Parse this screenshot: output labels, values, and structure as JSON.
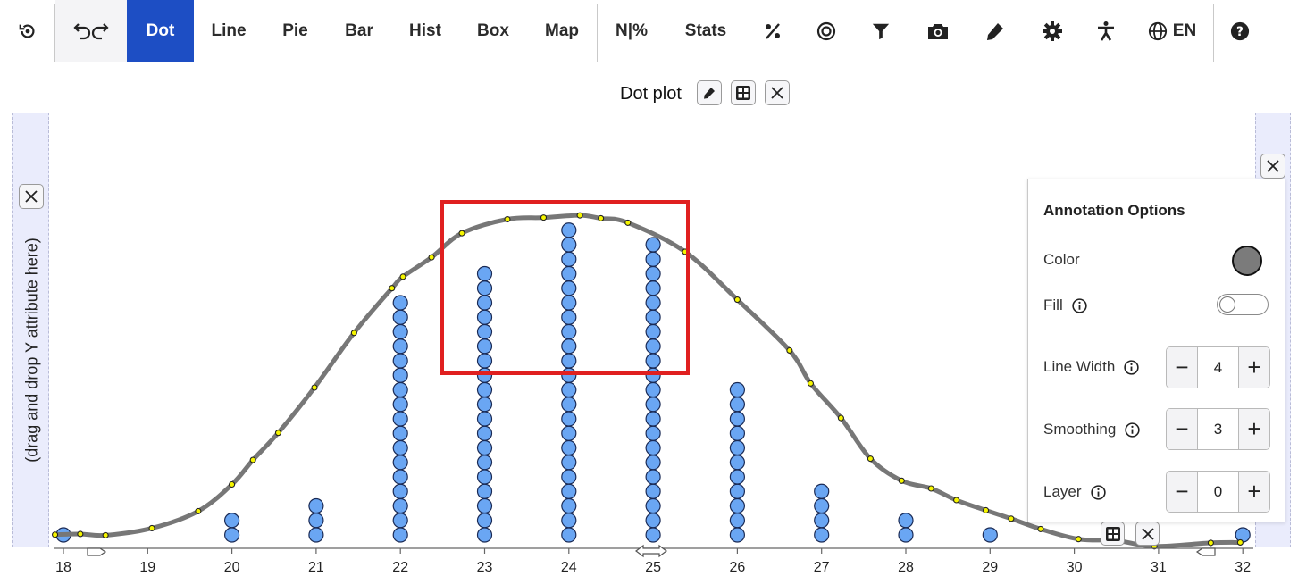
{
  "toolbar": {
    "undo_redo_icon": "undo-redo-icon",
    "reset_icon": "reset-icon",
    "tabs": [
      "Dot",
      "Line",
      "Pie",
      "Bar",
      "Hist",
      "Box",
      "Map"
    ],
    "active_tab": "Dot",
    "n_percent": "N|%",
    "stats": "Stats",
    "language": "EN",
    "accent_color": "#1d4ec4"
  },
  "plot": {
    "title": "Dot plot",
    "y_drop_hint": "(drag and drop Y attribute here)"
  },
  "chart_data": {
    "type": "scatter",
    "subtype": "dot plot with smoothed density line",
    "xlim": [
      18,
      32
    ],
    "x_ticks": [
      "18",
      "19",
      "20",
      "21",
      "22",
      "23",
      "24",
      "25",
      "26",
      "27",
      "28",
      "29",
      "30",
      "31",
      "32"
    ],
    "dot_counts": [
      {
        "x": 18,
        "count": 1
      },
      {
        "x": 20,
        "count": 2
      },
      {
        "x": 21,
        "count": 3
      },
      {
        "x": 22,
        "count": 17
      },
      {
        "x": 23,
        "count": 19
      },
      {
        "x": 24,
        "count": 22
      },
      {
        "x": 25,
        "count": 21
      },
      {
        "x": 26,
        "count": 11
      },
      {
        "x": 27,
        "count": 4
      },
      {
        "x": 28,
        "count": 2
      },
      {
        "x": 29,
        "count": 1
      },
      {
        "x": 32,
        "count": 1
      }
    ],
    "dot_color": "#6aa6f3",
    "curve": {
      "color": "#777777",
      "control_point_color": "#f5f500",
      "points": [
        [
          17.9,
          0.008
        ],
        [
          18.2,
          0.013
        ],
        [
          18.5,
          0.004
        ],
        [
          19.05,
          0.055
        ],
        [
          19.6,
          0.178
        ],
        [
          20.0,
          0.371
        ],
        [
          20.25,
          0.548
        ],
        [
          20.55,
          0.744
        ],
        [
          20.98,
          1.071
        ],
        [
          21.45,
          1.466
        ],
        [
          21.9,
          1.789
        ],
        [
          22.03,
          1.872
        ],
        [
          22.37,
          2.012
        ],
        [
          22.73,
          2.186
        ],
        [
          23.27,
          2.287
        ],
        [
          23.7,
          2.299
        ],
        [
          24.13,
          2.315
        ],
        [
          24.38,
          2.294
        ],
        [
          24.7,
          2.262
        ],
        [
          25.38,
          2.052
        ],
        [
          26.0,
          1.706
        ],
        [
          26.62,
          1.339
        ],
        [
          26.87,
          1.101
        ],
        [
          27.23,
          0.851
        ],
        [
          27.58,
          0.557
        ],
        [
          27.95,
          0.398
        ],
        [
          28.3,
          0.342
        ],
        [
          28.6,
          0.258
        ],
        [
          28.95,
          0.184
        ],
        [
          29.25,
          0.124
        ],
        [
          29.6,
          0.049
        ],
        [
          30.05,
          -0.024
        ],
        [
          30.5,
          -0.035
        ],
        [
          30.95,
          -0.076
        ],
        [
          31.62,
          -0.051
        ],
        [
          31.97,
          -0.048
        ]
      ],
      "ylim": [
        -0.1,
        2.5
      ]
    }
  },
  "highlight_box": {
    "color": "#e02020"
  },
  "annotation_panel": {
    "title": "Annotation Options",
    "color_label": "Color",
    "color_value": "#7b7b7b",
    "fill_label": "Fill",
    "fill_on": false,
    "line_width_label": "Line Width",
    "line_width_value": "4",
    "smoothing_label": "Smoothing",
    "smoothing_value": "3",
    "layer_label": "Layer",
    "layer_value": "0"
  }
}
